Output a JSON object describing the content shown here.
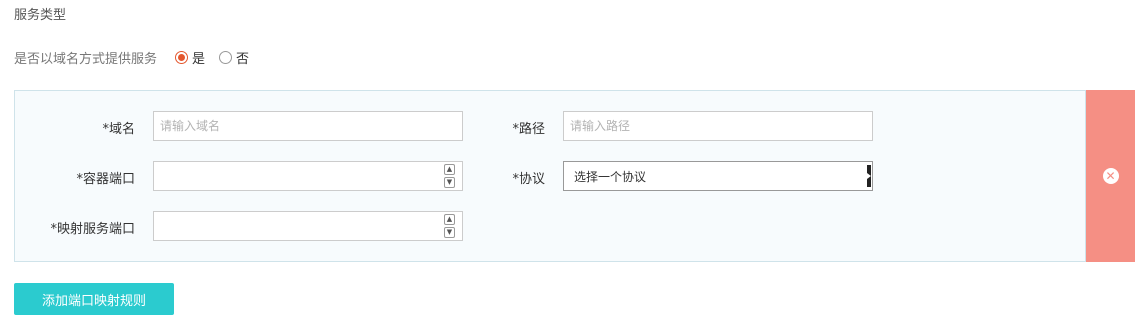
{
  "section_title": "服务类型",
  "domain_service": {
    "question": "是否以域名方式提供服务",
    "options": [
      {
        "label": "是",
        "checked": true
      },
      {
        "label": "否",
        "checked": false
      }
    ]
  },
  "rule": {
    "domain": {
      "label": "*域名",
      "placeholder": "请输入域名",
      "value": ""
    },
    "path": {
      "label": "*路径",
      "placeholder": "请输入路径",
      "value": ""
    },
    "container_port": {
      "label": "*容器端口",
      "value": ""
    },
    "protocol": {
      "label": "*协议",
      "selected": "选择一个协议"
    },
    "mapped_port": {
      "label": "*映射服务端口",
      "value": ""
    },
    "remove_icon": "close-circle-icon"
  },
  "add_button": "添加端口映射规则",
  "colors": {
    "accent_radio": "#e4572e",
    "remove_bg": "#f58f84",
    "add_button_bg": "#2bcbcf",
    "panel_bg": "#f7fbfd"
  }
}
